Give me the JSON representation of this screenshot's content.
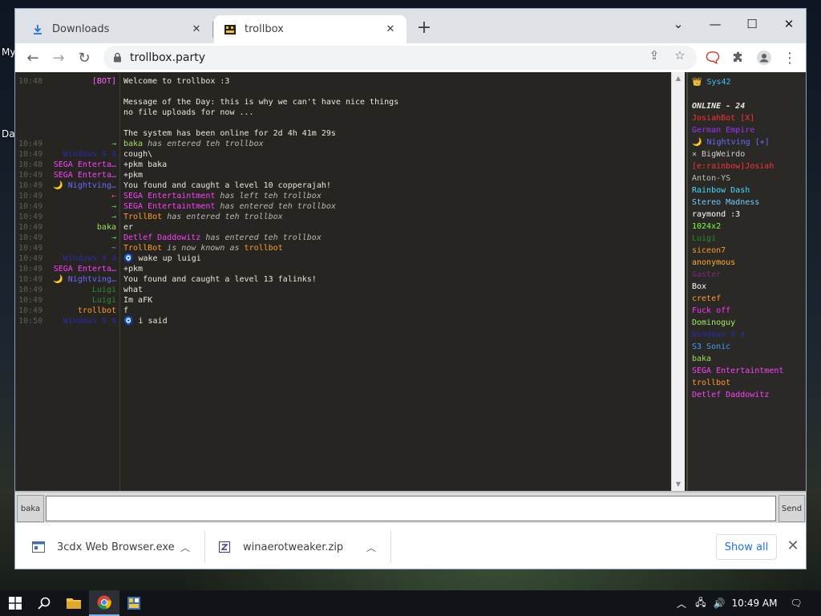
{
  "desktop": {
    "icon_labels": [
      "My",
      "Da"
    ]
  },
  "browser": {
    "tabs": [
      {
        "title": "Downloads",
        "icon": "download-icon",
        "active": false
      },
      {
        "title": "trollbox",
        "icon": "film-icon",
        "active": true
      }
    ],
    "address": "trollbox.party"
  },
  "chat": {
    "messages": [
      {
        "time": "10:48",
        "nick": "[BOT]",
        "nick_color": "#ff66ff",
        "text": "Welcome to trollbox :3",
        "style": "normal"
      },
      {
        "time": "",
        "nick": "",
        "nick_color": "#ffffff",
        "text": "Message of the Day: this is why we can't have nice things",
        "style": "normal"
      },
      {
        "time": "",
        "nick": "",
        "nick_color": "#ffffff",
        "text": "no file uploads for now ...",
        "style": "normal"
      },
      {
        "time": "",
        "nick": "",
        "nick_color": "#ffffff",
        "text": "The system has been online for 2d 4h 41m 29s",
        "style": "normal"
      },
      {
        "time": "10:49",
        "nick": "→",
        "nick_color": "#5fcf5f",
        "text_nick": "baka",
        "text_nick_color": "#9fdf5f",
        "text": "has entered teh trollbox",
        "style": "event"
      },
      {
        "time": "10:49",
        "nick": "Windows 9 4",
        "nick_color": "#2a2ab0",
        "text": "cough\\",
        "style": "normal"
      },
      {
        "time": "10:48",
        "nick": "SEGA Enterta…",
        "nick_color": "#ff40ff",
        "text": "+pkm baka",
        "style": "normal"
      },
      {
        "time": "10:49",
        "nick": "SEGA Enterta…",
        "nick_color": "#ff40ff",
        "text": "+pkm",
        "style": "normal"
      },
      {
        "time": "10:49",
        "nick": "🌙 Nightving…",
        "nick_color": "#6a6aff",
        "text": "You found and caught a level 10 copperajah!",
        "style": "normal"
      },
      {
        "time": "10:49",
        "nick": "←",
        "nick_color": "#ff5050",
        "text_nick": "SEGA Entertaintment",
        "text_nick_color": "#ff40ff",
        "text": "has left teh trollbox",
        "style": "event"
      },
      {
        "time": "10:49",
        "nick": "→",
        "nick_color": "#5fcf5f",
        "text_nick": "SEGA Entertaintment",
        "text_nick_color": "#ff40ff",
        "text": "has entered teh trollbox",
        "style": "event"
      },
      {
        "time": "10:49",
        "nick": "→",
        "nick_color": "#5fcf5f",
        "text_nick": "TrollBot",
        "text_nick_color": "#ff9a2a",
        "text": "has entered teh trollbox",
        "style": "event"
      },
      {
        "time": "10:49",
        "nick": "baka",
        "nick_color": "#9fdf5f",
        "text": "er",
        "style": "normal"
      },
      {
        "time": "10:49",
        "nick": "→",
        "nick_color": "#5fcf5f",
        "text_nick": "Detlef Daddowitz",
        "text_nick_color": "#ff40ff",
        "text": "has entered teh trollbox",
        "style": "event"
      },
      {
        "time": "10:49",
        "nick": "~",
        "nick_color": "#9a9a9a",
        "text_nick": "TrollBot",
        "text_nick_color": "#ff9a2a",
        "text": "is now known as",
        "text_tail": "trollbot",
        "text_tail_color": "#ff9a2a",
        "style": "event"
      },
      {
        "time": "10:49",
        "nick": "Windows 9 4",
        "nick_color": "#2a2ab0",
        "text": "🧿 wake up luigi",
        "style": "normal"
      },
      {
        "time": "10:49",
        "nick": "SEGA Enterta…",
        "nick_color": "#ff40ff",
        "text": "+pkm",
        "style": "normal"
      },
      {
        "time": "10:49",
        "nick": "🌙 Nightving…",
        "nick_color": "#6a6aff",
        "text": "You found and caught a level 13 falinks!",
        "style": "normal"
      },
      {
        "time": "10:49",
        "nick": "Luigi",
        "nick_color": "#2e8b2e",
        "text": "what",
        "style": "normal"
      },
      {
        "time": "10:49",
        "nick": "Luigi",
        "nick_color": "#2e8b2e",
        "text": "Im aFK",
        "style": "normal"
      },
      {
        "time": "10:49",
        "nick": "trollbot",
        "nick_color": "#ff9a2a",
        "text": "f",
        "style": "normal"
      },
      {
        "time": "10:50",
        "nick": "Windows 9 4",
        "nick_color": "#2a2ab0",
        "text": "🧿 i said",
        "style": "normal"
      }
    ]
  },
  "userlist": {
    "me": {
      "label": "👑 Sys42",
      "color": "#3fbfff"
    },
    "header": "ONLINE - 24",
    "users": [
      {
        "name": "JosiahBot [X]",
        "color": "#ff3030"
      },
      {
        "name": "German Empire",
        "color": "#a030ff"
      },
      {
        "name": "🌙 Nightving [+]",
        "color": "#6a6aff"
      },
      {
        "name": "✕ BigWeirdo",
        "color": "#cfcfcf"
      },
      {
        "name": "[e:rainbow]Josiah",
        "color": "#ff3030"
      },
      {
        "name": "Anton-YS",
        "color": "#bfbfbf"
      },
      {
        "name": "Rainbow Dash",
        "color": "#3fdfff"
      },
      {
        "name": "Stereo Madness",
        "color": "#6fcfff"
      },
      {
        "name": "raymond :3",
        "color": "#ffffff"
      },
      {
        "name": "1024x2",
        "color": "#7fff3f"
      },
      {
        "name": "Luigi",
        "color": "#2e8b2e"
      },
      {
        "name": "siceon7",
        "color": "#ff9a2a"
      },
      {
        "name": "anonymous",
        "color": "#ffaf2a"
      },
      {
        "name": "Gaster",
        "color": "#7a2a7a"
      },
      {
        "name": "Box",
        "color": "#ffffff"
      },
      {
        "name": "cretef",
        "color": "#ff9a2a"
      },
      {
        "name": "Fuck off",
        "color": "#ff30ff"
      },
      {
        "name": "Dominoguy",
        "color": "#9fef5f"
      },
      {
        "name": "Windows 9 4",
        "color": "#2a2ab0"
      },
      {
        "name": "S3 Sonic",
        "color": "#3f9fff"
      },
      {
        "name": "baka",
        "color": "#9fdf5f"
      },
      {
        "name": "SEGA Entertaintment",
        "color": "#ff40ff"
      },
      {
        "name": "trollbot",
        "color": "#ff9a2a"
      },
      {
        "name": "Detlef Daddowitz",
        "color": "#ff40ff"
      }
    ]
  },
  "input": {
    "nick": "baka",
    "value": "",
    "send": "Send"
  },
  "downloads": {
    "items": [
      {
        "name": "3cdx Web Browser.exe",
        "icon": "exe-icon"
      },
      {
        "name": "winaerotweaker.zip",
        "icon": "zip-icon"
      }
    ],
    "show_all": "Show all"
  },
  "taskbar": {
    "clock": "10:49 AM"
  }
}
